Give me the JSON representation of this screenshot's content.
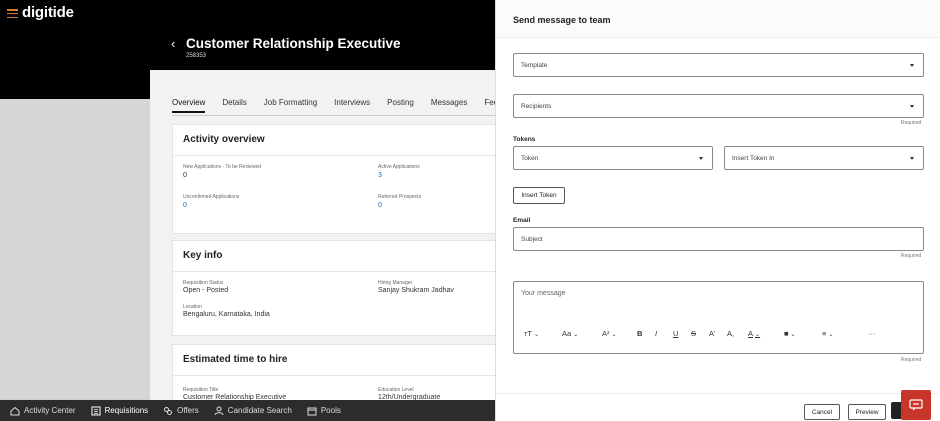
{
  "app": {
    "logo": "digitide",
    "requisition": {
      "title": "Customer Relationship Executive",
      "number": "258353"
    },
    "tabs": [
      "Overview",
      "Details",
      "Job Formatting",
      "Interviews",
      "Posting",
      "Messages",
      "Feedb"
    ],
    "activity": {
      "title": "Activity overview",
      "fields": [
        {
          "label": "New Applications - To be Reviewed",
          "value": "0"
        },
        {
          "label": "Active Applications",
          "value": "3"
        },
        {
          "label": "Unconfirmed Applications",
          "value": "0"
        },
        {
          "label": "Referred Prospects",
          "value": "0"
        }
      ]
    },
    "keyinfo": {
      "title": "Key info",
      "fields": [
        {
          "label": "Requisition Status",
          "value": "Open - Posted"
        },
        {
          "label": "Hiring Manager",
          "value": "Sanjay Shukram Jadhav"
        },
        {
          "label": "Location",
          "value": "Bengaluru, Karnataka, India"
        }
      ]
    },
    "estimate": {
      "title": "Estimated time to hire",
      "fields": [
        {
          "label": "Requisition Title",
          "value": "Customer Relationship Executive"
        },
        {
          "label": "Education Level",
          "value": "12th/Undergraduate"
        }
      ]
    },
    "bottom_nav": [
      {
        "label": "Activity Center",
        "icon": "home-icon"
      },
      {
        "label": "Requisitions",
        "icon": "list-icon"
      },
      {
        "label": "Offers",
        "icon": "offers-icon"
      },
      {
        "label": "Candidate Search",
        "icon": "person-search-icon"
      },
      {
        "label": "Pools",
        "icon": "pools-icon"
      }
    ]
  },
  "drawer": {
    "title": "Send message to team",
    "template_placeholder": "Template",
    "recipients_placeholder": "Recipients",
    "required": "Required",
    "tokens_label": "Tokens",
    "token_select": "Token",
    "insert_token_in": "Insert Token In",
    "insert_token_button": "Insert Token",
    "email_label": "Email",
    "subject_placeholder": "Subject",
    "message_placeholder": "Your message",
    "toolbar": [
      "тT",
      "Aa",
      "A²",
      "B",
      "I",
      "U",
      "S",
      "A'",
      "A,",
      "A",
      "■",
      "≡",
      "···"
    ],
    "cancel": "Cancel",
    "preview": "Preview"
  },
  "colors": {
    "accent": "#c8352b",
    "link": "#1c6fb5",
    "brand_orange": "#d97b2b"
  }
}
